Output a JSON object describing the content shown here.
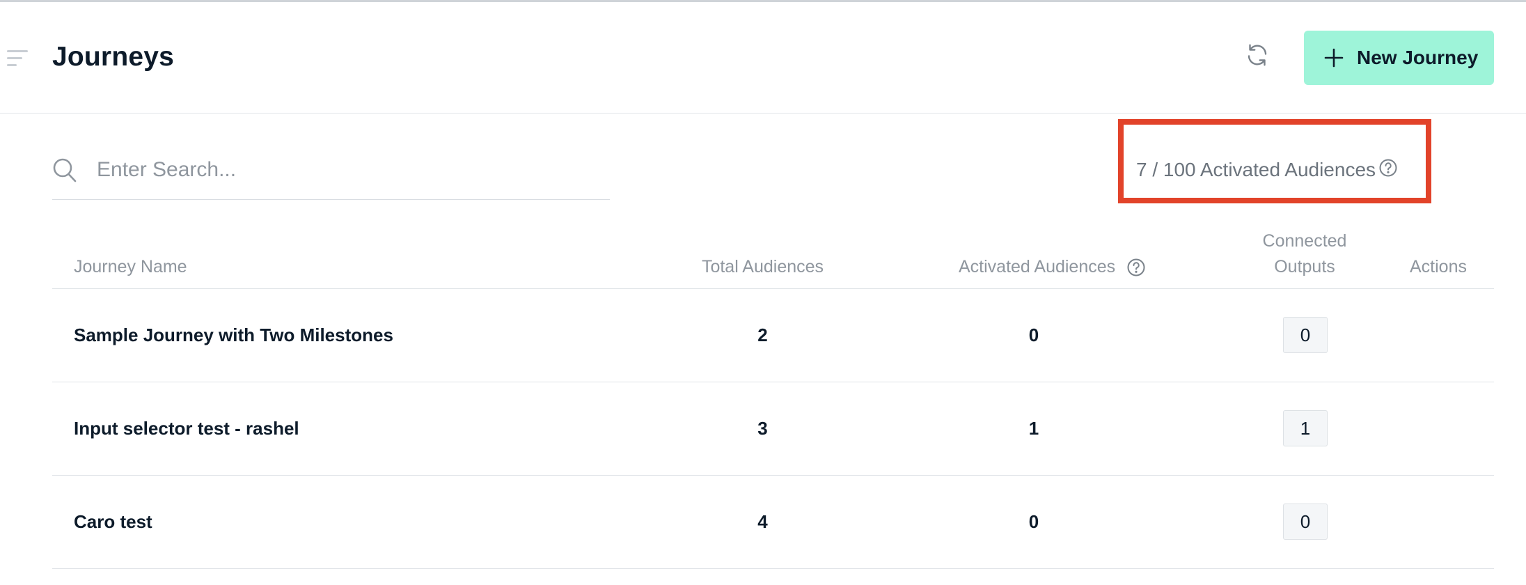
{
  "header": {
    "title": "Journeys",
    "new_button_label": "New Journey"
  },
  "search": {
    "placeholder": "Enter Search...",
    "value": ""
  },
  "quota": {
    "text": "7 / 100 Activated Audiences"
  },
  "table": {
    "columns": {
      "name": "Journey Name",
      "total": "Total Audiences",
      "activated": "Activated Audiences",
      "outputs": "Connected Outputs",
      "actions": "Actions"
    },
    "rows": [
      {
        "name": "Sample Journey with Two Milestones",
        "total": "2",
        "activated": "0",
        "outputs": "0"
      },
      {
        "name": "Input selector test - rashel",
        "total": "3",
        "activated": "1",
        "outputs": "1"
      },
      {
        "name": "Caro test",
        "total": "4",
        "activated": "0",
        "outputs": "0"
      }
    ]
  },
  "icons": {
    "menu": "menu-icon",
    "refresh": "refresh-icon",
    "plus": "plus-icon",
    "search": "search-icon",
    "help": "help-icon"
  },
  "colors": {
    "accent": "#9ef4d9",
    "highlight_border": "#e2432a",
    "text_primary": "#0d1b2a",
    "text_muted": "#8f969e"
  }
}
